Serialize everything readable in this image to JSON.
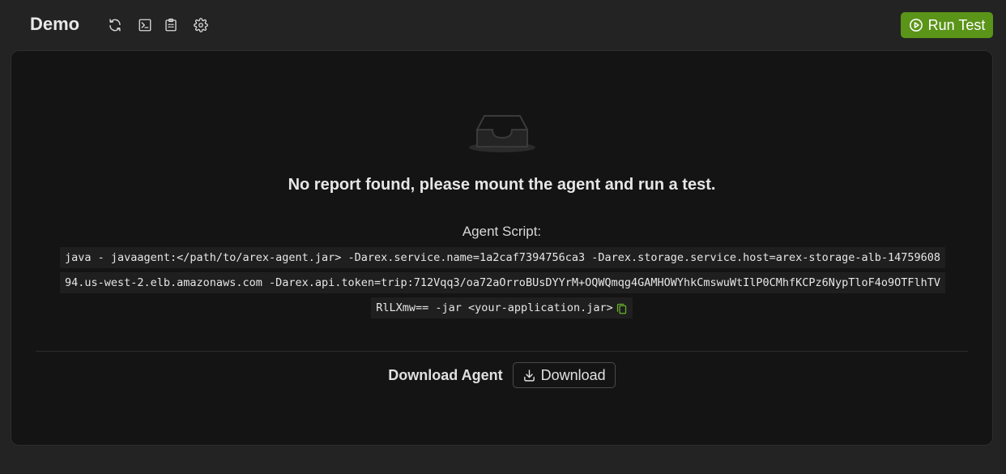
{
  "header": {
    "title": "Demo",
    "toolbar_icons": [
      "refresh-icon",
      "terminal-icon",
      "report-icon",
      "settings-icon"
    ],
    "run_button_label": "Run Test"
  },
  "empty_state": {
    "icon": "empty-inbox-icon",
    "message": "No report found, please mount the agent and run a test."
  },
  "agent_script": {
    "label": "Agent Script:",
    "command": "java - javaagent:</path/to/arex-agent.jar> -Darex.service.name=1a2caf7394756ca3 -Darex.storage.service.host=arex-storage-alb-1475960894.us-west-2.elb.amazonaws.com -Darex.api.token=trip:712Vqq3/oa72aOrroBUsDYYrM+OQWQmqg4GAMHOWYhkCmswuWtIlP0CMhfKCPz6NypTloF4o9OTFlhTVRlLXmw== -jar <your-application.jar>",
    "copy_icon": "copy-icon"
  },
  "download": {
    "label": "Download Agent",
    "button_label": "Download"
  },
  "colors": {
    "accent": "#5a9418",
    "background": "#232323",
    "panel": "#141414"
  }
}
